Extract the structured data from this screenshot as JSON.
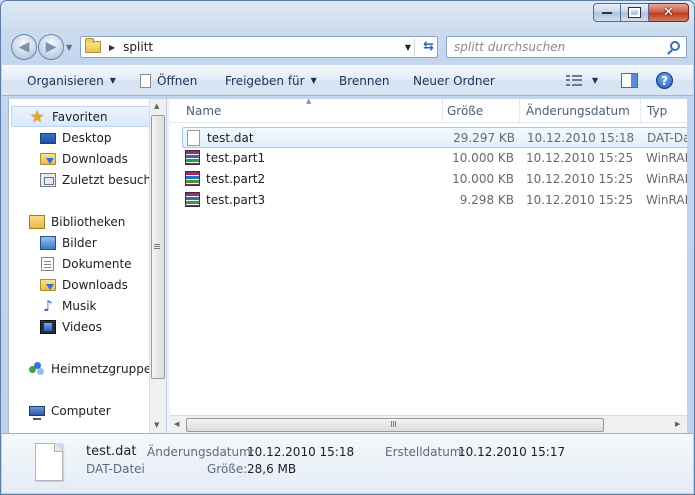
{
  "window": {
    "title": "splitt",
    "accent": "#4f6d95",
    "close_glyph": "✕"
  },
  "address": {
    "path": "splitt",
    "search_placeholder": "splitt durchsuchen"
  },
  "toolbar": {
    "organize": "Organisieren",
    "open": "Öffnen",
    "share": "Freigeben für",
    "burn": "Brennen",
    "new_folder": "Neuer Ordner"
  },
  "navpane": {
    "favorites": "Favoriten",
    "desktop": "Desktop",
    "downloads": "Downloads",
    "recent": "Zuletzt besucht",
    "libraries": "Bibliotheken",
    "pictures": "Bilder",
    "documents": "Dokumente",
    "lib_downloads": "Downloads",
    "music": "Musik",
    "videos": "Videos",
    "homegroup": "Heimnetzgruppe",
    "computer": "Computer"
  },
  "columns": {
    "name": "Name",
    "size": "Größe",
    "date": "Änderungsdatum",
    "type": "Typ"
  },
  "files": [
    {
      "name": "test.dat",
      "size": "29.297 KB",
      "date": "10.12.2010 15:18",
      "type": "DAT-Datei",
      "icon": "dat-file-icon"
    },
    {
      "name": "test.part1",
      "size": "10.000 KB",
      "date": "10.12.2010 15:25",
      "type": "WinRAR-Archiv",
      "icon": "rar-archive-icon"
    },
    {
      "name": "test.part2",
      "size": "10.000 KB",
      "date": "10.12.2010 15:25",
      "type": "WinRAR-Archiv",
      "icon": "rar-archive-icon"
    },
    {
      "name": "test.part3",
      "size": "9.298 KB",
      "date": "10.12.2010 15:25",
      "type": "WinRAR-Archiv",
      "icon": "rar-archive-icon"
    }
  ],
  "details": {
    "file_name": "test.dat",
    "file_type": "DAT-Datei",
    "modified_label": "Änderungsdatum:",
    "modified_value": "10.12.2010 15:18",
    "size_label": "Größe:",
    "size_value": "28,6 MB",
    "created_label": "Erstelldatum:",
    "created_value": "10.12.2010 15:17"
  }
}
